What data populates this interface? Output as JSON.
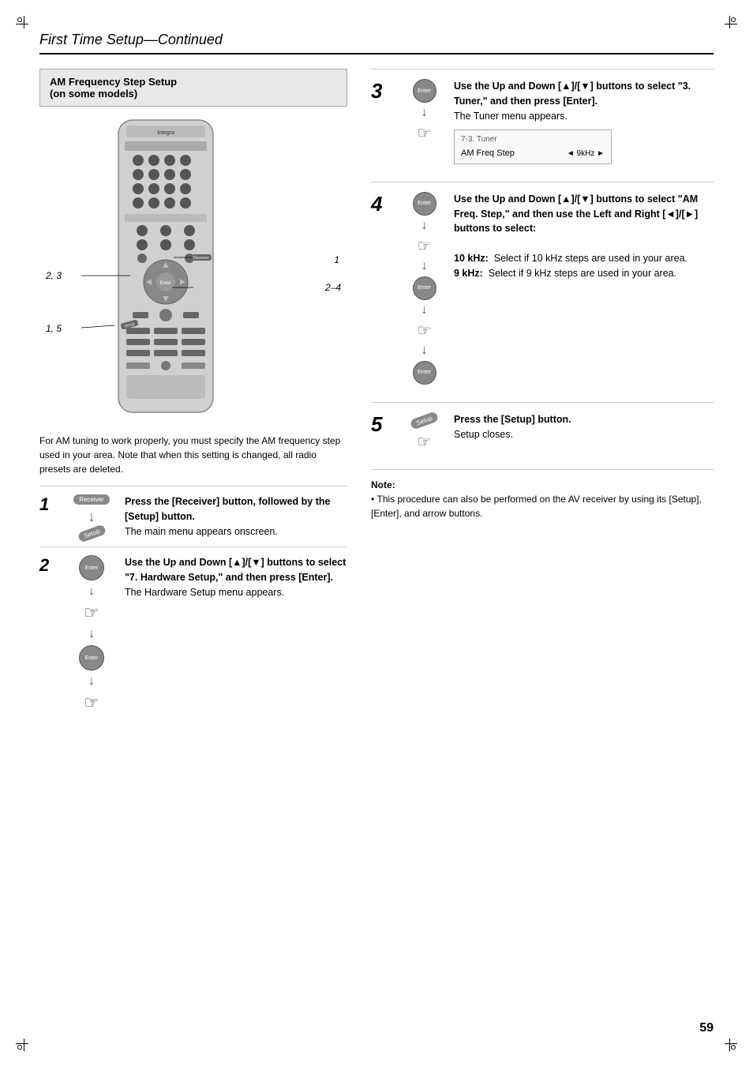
{
  "page": {
    "title": "First Time Setup",
    "title_continued": "—Continued",
    "page_number": "59"
  },
  "am_freq_box": {
    "title_line1": "AM Frequency Step Setup",
    "title_line2": "(on some models)"
  },
  "desc_text": "For AM tuning to work properly, you must specify the AM frequency step used in your area. Note that when this setting is changed, all radio presets are deleted.",
  "labels": {
    "l1": "1",
    "l23": "2, 3",
    "l24": "2–4",
    "l15": "1, 5"
  },
  "steps_left": [
    {
      "number": "1",
      "title": "Press the [Receiver] button, followed by the [Setup] button.",
      "body": "The main menu appears onscreen."
    },
    {
      "number": "2",
      "title": "Use the Up and Down [▲]/[▼] buttons to select \"7. Hardware Setup,\" and then press [Enter].",
      "body": "The Hardware Setup menu appears."
    }
  ],
  "steps_right": [
    {
      "number": "3",
      "title": "Use the Up and Down [▲]/[▼] buttons to select \"3. Tuner,\" and then press [Enter].",
      "body": "The Tuner menu appears.",
      "menu": {
        "label": "7-3. Tuner",
        "row_label": "AM Freq Step",
        "row_value": "◄ 9kHz ►"
      }
    },
    {
      "number": "4",
      "title": "Use the Up and Down [▲]/[▼] buttons to select \"AM Freq. Step,\" and then use the Left and Right [◄]/[►] buttons to select:",
      "options": [
        {
          "label": "10 kHz:",
          "desc": "Select if 10 kHz steps are used in your area."
        },
        {
          "label": "9 kHz:",
          "desc": "Select if 9 kHz steps are used in your area."
        }
      ]
    },
    {
      "number": "5",
      "title": "Press the [Setup] button.",
      "body": "Setup closes."
    }
  ],
  "note": {
    "label": "Note:",
    "bullet": "This procedure can also be performed on the AV receiver by using its [Setup], [Enter], and arrow buttons."
  }
}
